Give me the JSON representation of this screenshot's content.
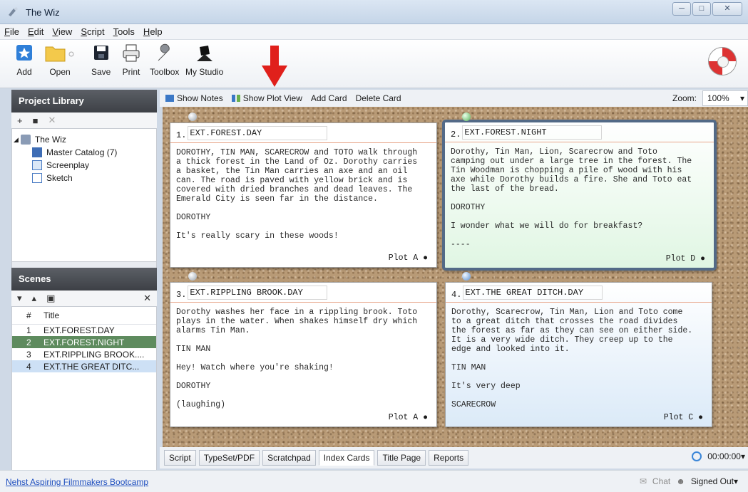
{
  "window": {
    "title": "The Wiz"
  },
  "menu": [
    "File",
    "Edit",
    "View",
    "Script",
    "Tools",
    "Help"
  ],
  "toolbar": {
    "buttons": [
      {
        "label": "Add",
        "icon": "add-star-icon"
      },
      {
        "label": "Open",
        "icon": "folder-icon"
      },
      {
        "label": "Save",
        "icon": "floppy-disk-icon"
      },
      {
        "label": "Print",
        "icon": "printer-icon"
      },
      {
        "label": "Toolbox",
        "icon": "wrench-icon"
      },
      {
        "label": "My Studio",
        "icon": "director-icon"
      }
    ]
  },
  "library": {
    "header": "Project Library",
    "project": "The Wiz",
    "items": [
      "Master Catalog (7)",
      "Screenplay",
      "Sketch"
    ]
  },
  "scenes": {
    "header": "Scenes",
    "columns": [
      "#",
      "Title"
    ],
    "rows": [
      {
        "num": "1",
        "title": "EXT.FOREST.DAY"
      },
      {
        "num": "2",
        "title": "EXT.FOREST.NIGHT"
      },
      {
        "num": "3",
        "title": "EXT.RIPPLING BROOK...."
      },
      {
        "num": "4",
        "title": "EXT.THE GREAT DITC..."
      }
    ]
  },
  "main_actions": [
    "Show Notes",
    "Show Plot View",
    "Add Card",
    "Delete Card"
  ],
  "zoom": {
    "label": "Zoom:",
    "value": "100%"
  },
  "cards": [
    {
      "num": "1.",
      "heading": "EXT.FOREST.DAY",
      "body": "DOROTHY, TIN MAN, SCARECROW and TOTO walk through\na thick forest in the Land of Oz. Dorothy carries\na basket, the Tin Man carries an axe and an oil\ncan. The road is paved with yellow brick and is\ncovered with dried branches and dead leaves. The\nEmerald City is seen far in the distance.\n\nDOROTHY\n\nIt's really scary in these woods!",
      "plot": "Plot A"
    },
    {
      "num": "2.",
      "heading": "EXT.FOREST.NIGHT",
      "body": "Dorothy, Tin Man, Lion, Scarecrow and Toto\ncamping out under a large tree in the forest. The\nTin Woodman is chopping a pile of wood with his\naxe while Dorothy builds a fire. She and Toto eat\nthe last of the bread.\n\nDOROTHY\n\nI wonder what we will do for breakfast?\n\n----",
      "plot": "Plot D"
    },
    {
      "num": "3.",
      "heading": "EXT.RIPPLING BROOK.DAY",
      "body": "Dorothy washes her face in a rippling brook. Toto\nplays in the water. When shakes himself dry which\nalarms Tin Man.\n\nTIN MAN\n\nHey! Watch where you're shaking!\n\nDOROTHY\n\n(laughing)",
      "plot": "Plot A"
    },
    {
      "num": "4.",
      "heading": "EXT.THE GREAT DITCH.DAY",
      "body": "Dorothy, Scarecrow, Tin Man, Lion and Toto come\nto a great ditch that crosses the road divides\nthe forest as far as they can see on either side.\nIt is a very wide ditch. They creep up to the\nedge and looked into it.\n\nTIN MAN\n\nIt's very deep\n\nSCARECROW",
      "plot": "Plot C"
    }
  ],
  "tabs": [
    "Script",
    "TypeSet/PDF",
    "Scratchpad",
    "Index Cards",
    "Title Page",
    "Reports"
  ],
  "active_tab": "Index Cards",
  "timer": "00:00:00",
  "status": {
    "link": "Nehst Aspiring Filmmakers Bootcamp",
    "chat": "Chat",
    "signed": "Signed Out"
  },
  "colors": {
    "selected_green": "#5e8b5e",
    "selected_blue": "#cde0f5",
    "card_frame": "#536a87",
    "accent_red": "#e0201b"
  }
}
